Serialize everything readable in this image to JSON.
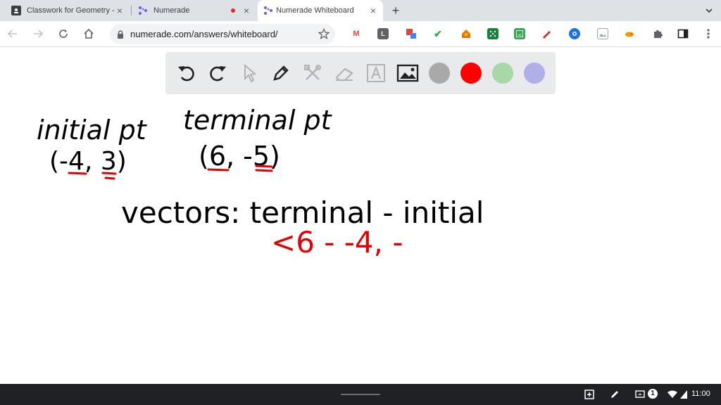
{
  "tabs": [
    {
      "title": "Classwork for Geometry - Han"
    },
    {
      "title": "Numerade"
    },
    {
      "title": "Numerade Whiteboard"
    }
  ],
  "new_tab_label": "+",
  "address": {
    "url": "numerade.com/answers/whiteboard/"
  },
  "extensions": [
    {
      "icon": "gmail-icon",
      "label": "M",
      "color": "#ea4335"
    },
    {
      "icon": "l-icon",
      "label": "L",
      "color": "#5f6368"
    },
    {
      "icon": "translate-icon",
      "label": "",
      "color": "#4285f4"
    },
    {
      "icon": "check-icon",
      "label": "✔",
      "color": "#34a853"
    },
    {
      "icon": "home-icon",
      "label": "",
      "color": "#e8710a"
    },
    {
      "icon": "dice-icon",
      "label": "",
      "color": "#188038"
    },
    {
      "icon": "smile-icon",
      "label": "",
      "color": "#34a853"
    },
    {
      "icon": "pen-icon",
      "label": "",
      "color": "#d93025"
    },
    {
      "icon": "globe-icon",
      "label": "",
      "color": "#1a73e8"
    },
    {
      "icon": "image-icon",
      "label": "",
      "color": "#9aa0a6"
    },
    {
      "icon": "bird-icon",
      "label": "",
      "color": "#f29900"
    }
  ],
  "whiteboard": {
    "colors": [
      "#a9a9a9",
      "#ff0000",
      "#a8d8a8",
      "#b0b0e8"
    ]
  },
  "handwriting": {
    "initial_label": "initial pt",
    "initial_point": "(-4, 3)",
    "terminal_label": "terminal pt",
    "terminal_point": "(6, -5)",
    "vectors_line": "vectors: terminal - initial",
    "work_line": "<6 - -4, -"
  },
  "shelf": {
    "notification_count": "1",
    "time": "11:00"
  }
}
